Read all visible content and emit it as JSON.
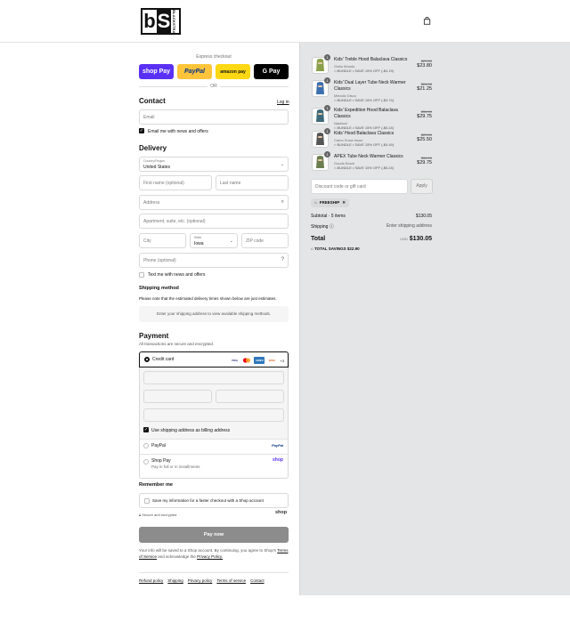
{
  "header": {
    "logo_letters": [
      "b",
      "S"
    ],
    "logo_side_text": "BLACKSTRAP",
    "cart_icon": "shopping-bag-icon"
  },
  "express": {
    "label": "Express checkout",
    "buttons": [
      "shop Pay",
      "PayPal",
      "amazon pay",
      "G Pay"
    ],
    "or": "OR"
  },
  "contact": {
    "title": "Contact",
    "login": "Log in",
    "email_placeholder": "Email",
    "news_label": "Email me with news and offers",
    "news_checked": true
  },
  "delivery": {
    "title": "Delivery",
    "country_label": "Country/Region",
    "country_value": "United States",
    "first_name": "First name (optional)",
    "last_name": "Last name",
    "address": "Address",
    "apartment": "Apartment, suite, etc. (optional)",
    "city": "City",
    "state_label": "State",
    "state_value": "Iowa",
    "zip": "ZIP code",
    "phone": "Phone (optional)",
    "text_label": "Text me with news and offers"
  },
  "shipping": {
    "title": "Shipping method",
    "note": "Please note that the estimated delivery times shown below are just estimates.",
    "placeholder": "Enter your shipping address to view available shipping methods."
  },
  "payment": {
    "title": "Payment",
    "subtitle": "All transactions are secure and encrypted.",
    "credit_card": "Credit card",
    "cards": [
      "VISA",
      "MC",
      "AMEX",
      "DISC"
    ],
    "more": "+3",
    "billing_label": "Use shipping address as billing address",
    "paypal": "PayPal",
    "paypal_logo": "PayPal",
    "shop_pay": "Shop Pay",
    "shop_pay_sub": "Pay in full or in installments",
    "shop_logo": "shop"
  },
  "remember": {
    "title": "Remember me",
    "save_label": "Save my information for a faster checkout with a Shop account",
    "secure": "Secure and encrypted",
    "shop_logo": "shop"
  },
  "pay_now": "Pay now",
  "legal": {
    "text1": "Your info will be saved to a Shop account. By continuing, you agree to Shop's",
    "tos": "Terms of Service",
    "text2": "and acknowledge the",
    "privacy": "Privacy Policy."
  },
  "footer": [
    "Refund policy",
    "Shipping",
    "Privacy policy",
    "Terms of service",
    "Contact"
  ],
  "items": [
    {
      "qty": "1",
      "name": "Kids' Treble Hood Balaclava Classics",
      "variant": "Gotta Woods",
      "bundle": "BUNDLE • SAVE 15% OFF (-$4.19)",
      "compare": "$27.99",
      "price": "$23.80",
      "color": "#8aa04a"
    },
    {
      "qty": "1",
      "name": "Kids' Dual Layer Tube Neck Warmer Classics",
      "variant": "Melodic Disco",
      "bundle": "BUNDLE • SAVE 15% OFF (-$3.74)",
      "compare": "$24.99",
      "price": "$21.25",
      "color": "#3b6fb0"
    },
    {
      "qty": "1",
      "name": "Kids' Expedition Hood Balaclava Classics",
      "variant": "Nautical",
      "bundle": "BUNDLE • SAVE 15% OFF (-$5.24)",
      "compare": "$34.99",
      "price": "$29.75",
      "color": "#3d6a7a"
    },
    {
      "qty": "1",
      "name": "Kids' Hood Balaclava Classics",
      "variant": "Camo Snow Issue",
      "bundle": "BUNDLE • SAVE 15% OFF (-$4.49)",
      "compare": "$29.99",
      "price": "$25.50",
      "color": "#555555"
    },
    {
      "qty": "1",
      "name": "APEX Tube Neck Warmer Classics",
      "variant": "Goods Brock",
      "bundle": "BUNDLE • SAVE 15% OFF (-$5.24)",
      "compare": "$34.99",
      "price": "$29.75",
      "color": "#6b7d4f"
    }
  ],
  "discount": {
    "placeholder": "Discount code or gift card",
    "apply": "Apply",
    "tag": "FREESHIP"
  },
  "summary": {
    "subtotal_label": "Subtotal · 5 items",
    "subtotal": "$130.05",
    "shipping_label": "Shipping",
    "shipping_value": "Enter shipping address",
    "total_label": "Total",
    "currency": "USD",
    "total": "$130.05",
    "savings_label": "TOTAL SAVINGS",
    "savings": "$22.90"
  }
}
